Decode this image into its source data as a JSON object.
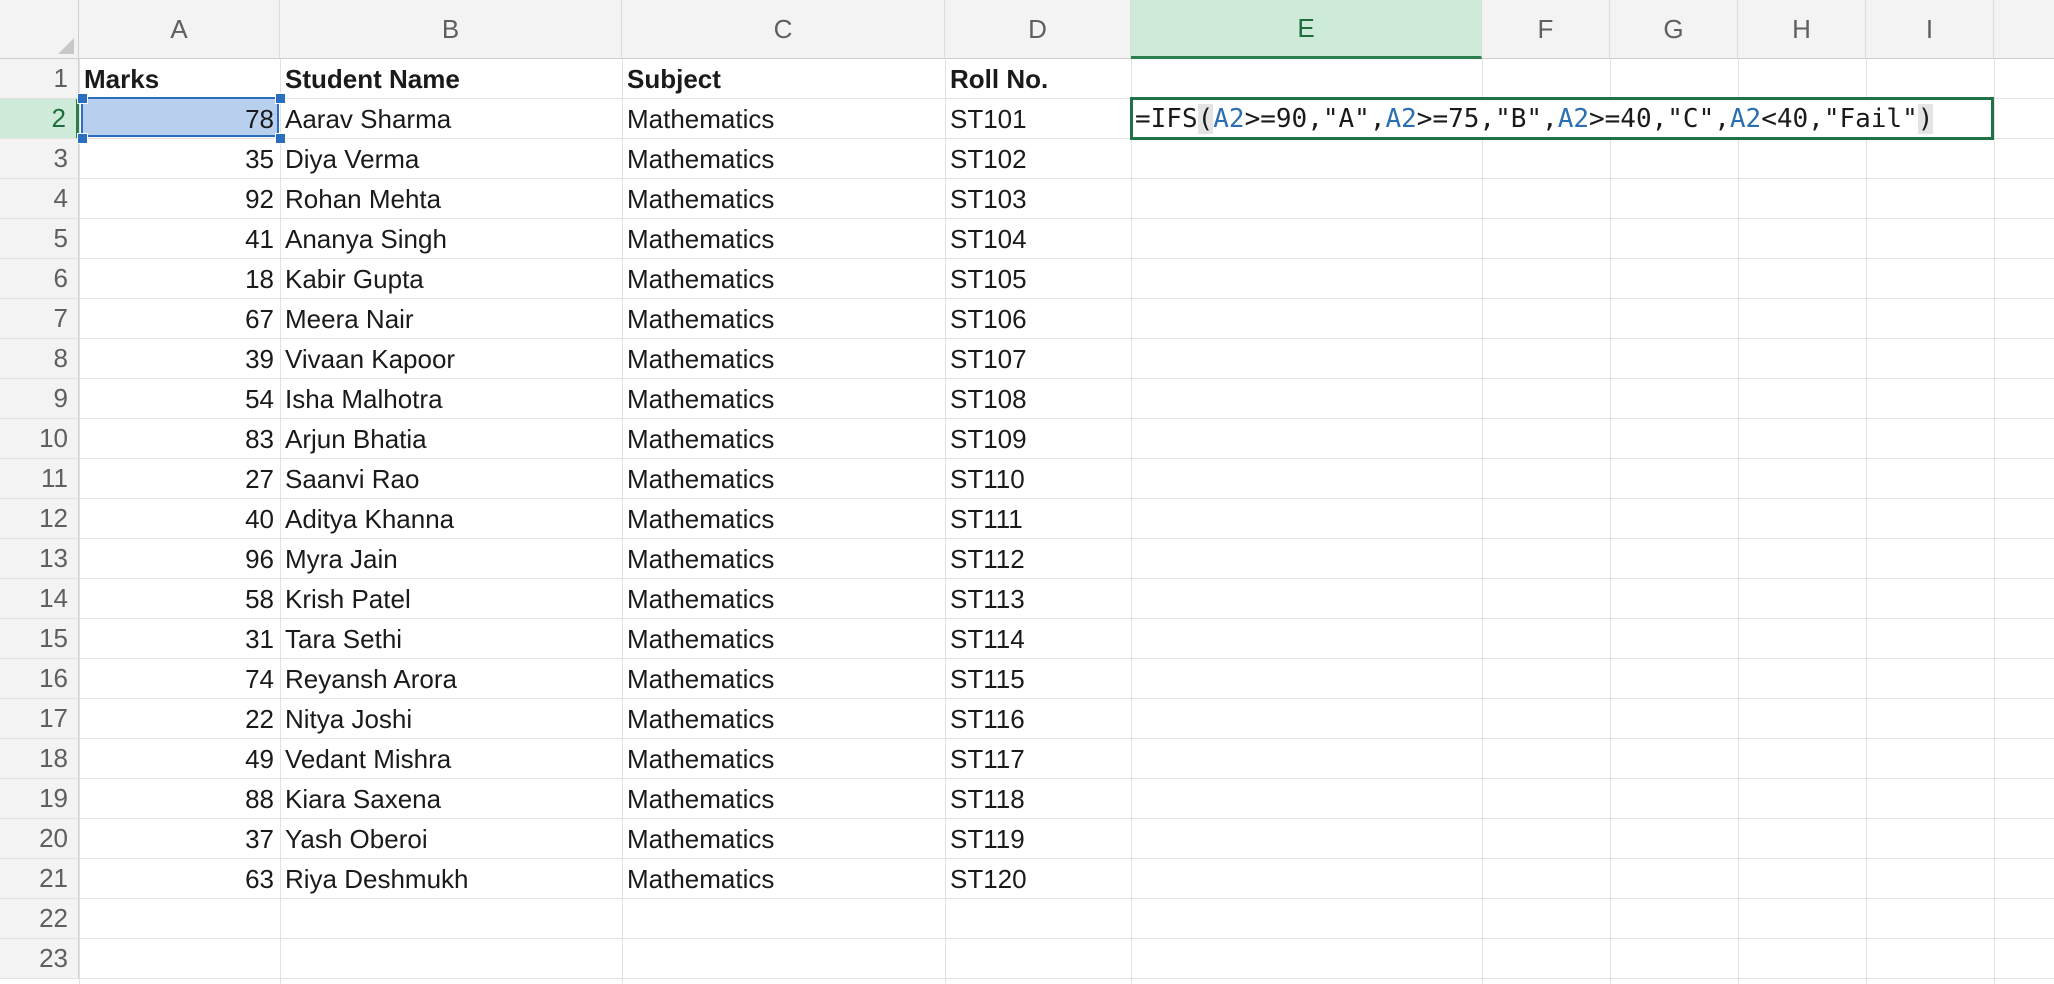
{
  "columns": [
    "A",
    "B",
    "C",
    "D",
    "E",
    "F",
    "G",
    "H",
    "I"
  ],
  "active_column": "E",
  "active_row": "2",
  "row_numbers": [
    "1",
    "2",
    "3",
    "4",
    "5",
    "6",
    "7",
    "8",
    "9",
    "10",
    "11",
    "12",
    "13",
    "14",
    "15",
    "16",
    "17",
    "18",
    "19",
    "20",
    "21",
    "22",
    "23"
  ],
  "headers": {
    "marks": "Marks",
    "student_name": "Student Name",
    "subject": "Subject",
    "roll_no": "Roll No."
  },
  "rows": [
    {
      "marks": "78",
      "name": "Aarav Sharma",
      "subject": "Mathematics",
      "roll": "ST101"
    },
    {
      "marks": "35",
      "name": "Diya Verma",
      "subject": "Mathematics",
      "roll": "ST102"
    },
    {
      "marks": "92",
      "name": "Rohan Mehta",
      "subject": "Mathematics",
      "roll": "ST103"
    },
    {
      "marks": "41",
      "name": "Ananya Singh",
      "subject": "Mathematics",
      "roll": "ST104"
    },
    {
      "marks": "18",
      "name": "Kabir Gupta",
      "subject": "Mathematics",
      "roll": "ST105"
    },
    {
      "marks": "67",
      "name": "Meera Nair",
      "subject": "Mathematics",
      "roll": "ST106"
    },
    {
      "marks": "39",
      "name": "Vivaan Kapoor",
      "subject": "Mathematics",
      "roll": "ST107"
    },
    {
      "marks": "54",
      "name": "Isha Malhotra",
      "subject": "Mathematics",
      "roll": "ST108"
    },
    {
      "marks": "83",
      "name": "Arjun Bhatia",
      "subject": "Mathematics",
      "roll": "ST109"
    },
    {
      "marks": "27",
      "name": "Saanvi Rao",
      "subject": "Mathematics",
      "roll": "ST110"
    },
    {
      "marks": "40",
      "name": "Aditya Khanna",
      "subject": "Mathematics",
      "roll": "ST111"
    },
    {
      "marks": "96",
      "name": "Myra Jain",
      "subject": "Mathematics",
      "roll": "ST112"
    },
    {
      "marks": "58",
      "name": "Krish Patel",
      "subject": "Mathematics",
      "roll": "ST113"
    },
    {
      "marks": "31",
      "name": "Tara Sethi",
      "subject": "Mathematics",
      "roll": "ST114"
    },
    {
      "marks": "74",
      "name": "Reyansh Arora",
      "subject": "Mathematics",
      "roll": "ST115"
    },
    {
      "marks": "22",
      "name": "Nitya Joshi",
      "subject": "Mathematics",
      "roll": "ST116"
    },
    {
      "marks": "49",
      "name": "Vedant Mishra",
      "subject": "Mathematics",
      "roll": "ST117"
    },
    {
      "marks": "88",
      "name": "Kiara Saxena",
      "subject": "Mathematics",
      "roll": "ST118"
    },
    {
      "marks": "37",
      "name": "Yash Oberoi",
      "subject": "Mathematics",
      "roll": "ST119"
    },
    {
      "marks": "63",
      "name": "Riya Deshmukh",
      "subject": "Mathematics",
      "roll": "ST120"
    }
  ],
  "formula_tokens": [
    {
      "t": "=IFS",
      "k": "plain"
    },
    {
      "t": "(",
      "k": "paren"
    },
    {
      "t": "A2",
      "k": "ref"
    },
    {
      "t": ">=90,\"A\",",
      "k": "plain"
    },
    {
      "t": "A2",
      "k": "ref"
    },
    {
      "t": ">=75,\"B\",",
      "k": "plain"
    },
    {
      "t": "A2",
      "k": "ref"
    },
    {
      "t": ">=40,\"C\",",
      "k": "plain"
    },
    {
      "t": "A2",
      "k": "ref"
    },
    {
      "t": "<40,\"Fail\"",
      "k": "plain"
    },
    {
      "t": ")",
      "k": "paren"
    }
  ],
  "colors": {
    "header_bg": "#f3f3f3",
    "active_header_bg": "#cdebd8",
    "active_green": "#1e7245",
    "selection_fill": "#b8cfee",
    "reference_blue": "#2b6fb3"
  }
}
